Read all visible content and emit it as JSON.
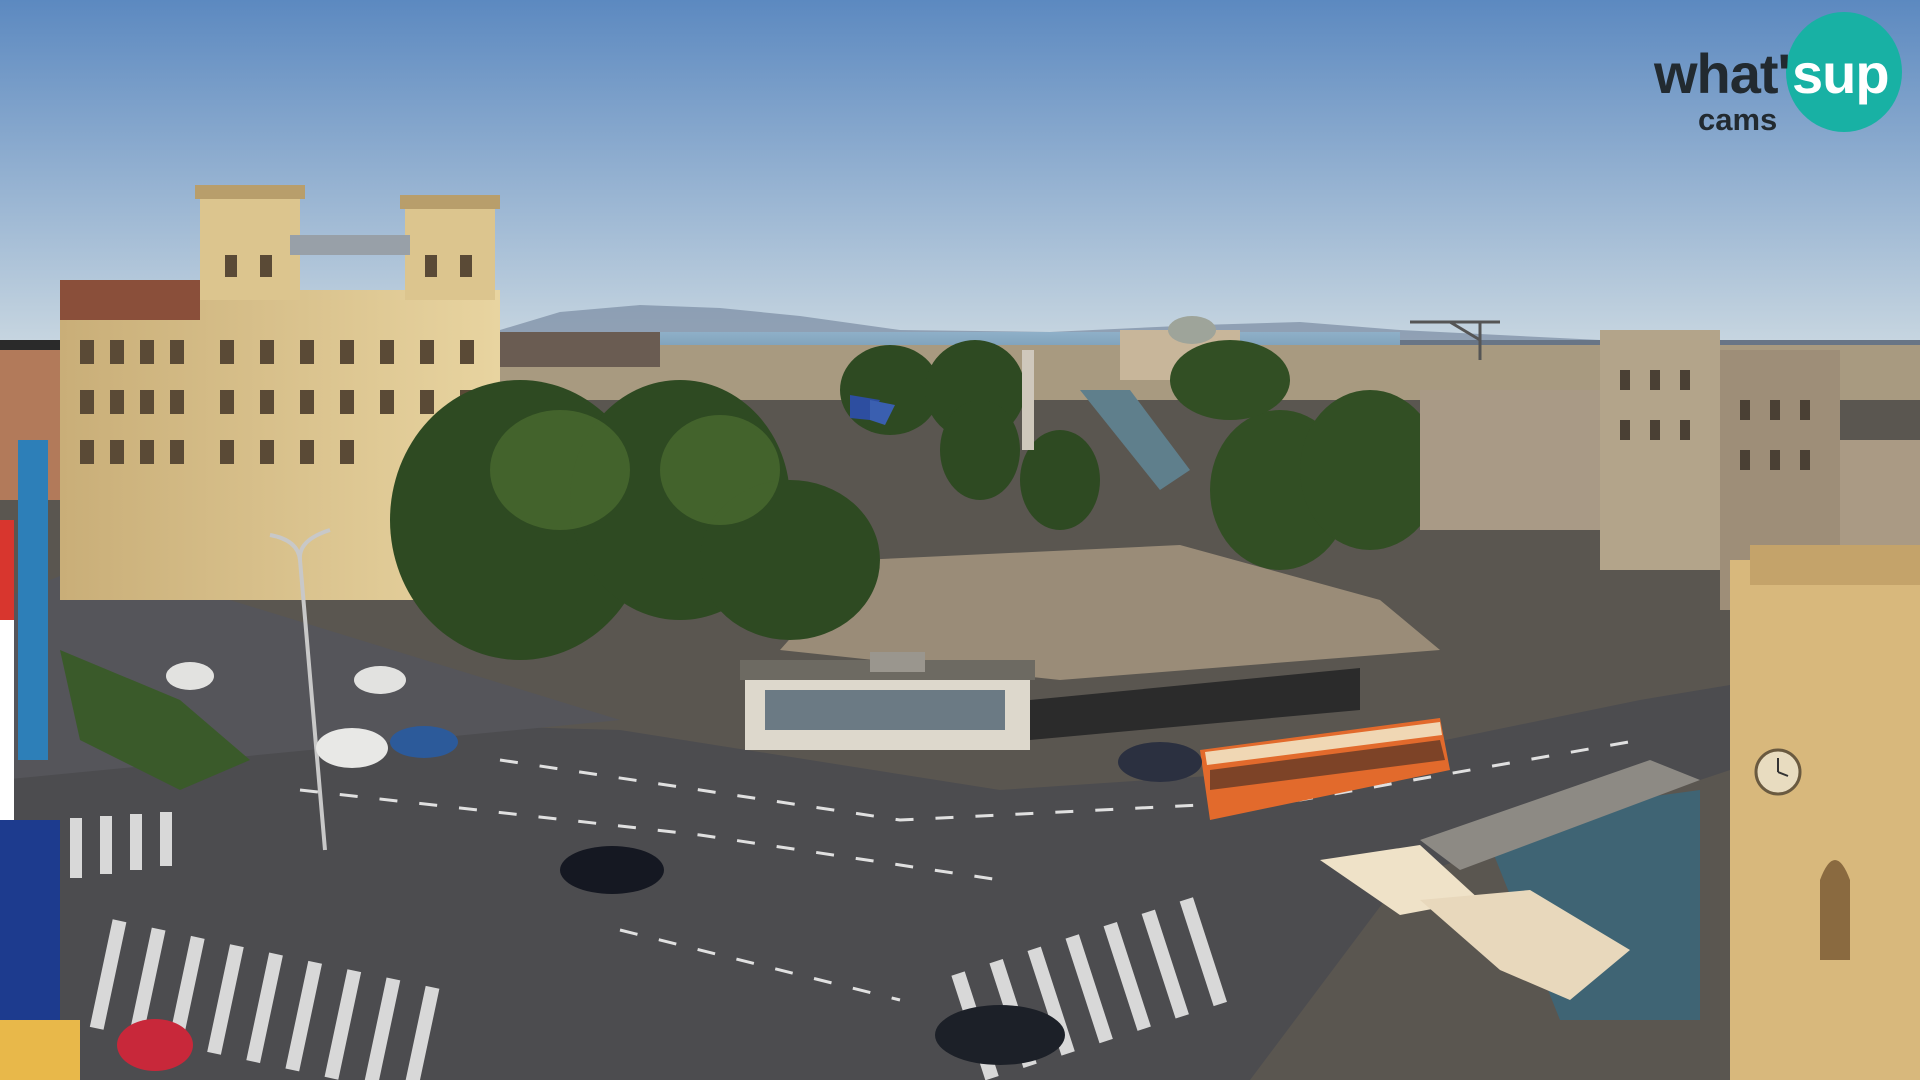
{
  "logo": {
    "part1": "what'",
    "part2": "sup",
    "part3": "cams",
    "accent_color": "#18b1a4",
    "text_color": "#222a30"
  },
  "colors": {
    "sky_top": "#5f8bbf",
    "sky_bottom": "#c3d3df",
    "sea": "#7ea3c0",
    "road": "#4c4c4f",
    "tree": "#2e4a22",
    "building": "#d9c38f",
    "bus": "#e26a2c"
  }
}
